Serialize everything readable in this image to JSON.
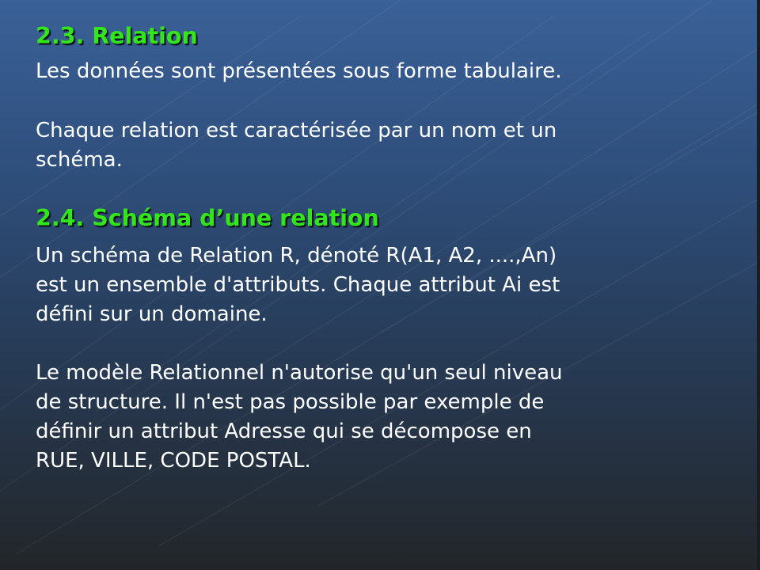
{
  "slide": {
    "heading_1": "2.3. Relation",
    "para_1": "Les données sont présentées sous forme tabulaire.",
    "para_2": "Chaque relation est caractérisée par un nom et un\nschéma.",
    "heading_2": "2.4. Schéma d’une relation",
    "para_3": "Un schéma de Relation R, dénoté R(A1, A2, ....,An)\nest un ensemble d'attributs. Chaque attribut Ai est\ndéfini sur un domaine.",
    "para_4": "Le modèle Relationnel n'autorise qu'un seul niveau\nde structure. Il n'est pas possible par exemple de\ndéfinir un attribut Adresse qui se décompose en\nRUE, VILLE, CODE POSTAL.",
    "colors": {
      "heading": "#33e619",
      "text": "#ffffff",
      "background_top": "#3a6198",
      "background_bottom": "#222629"
    }
  }
}
